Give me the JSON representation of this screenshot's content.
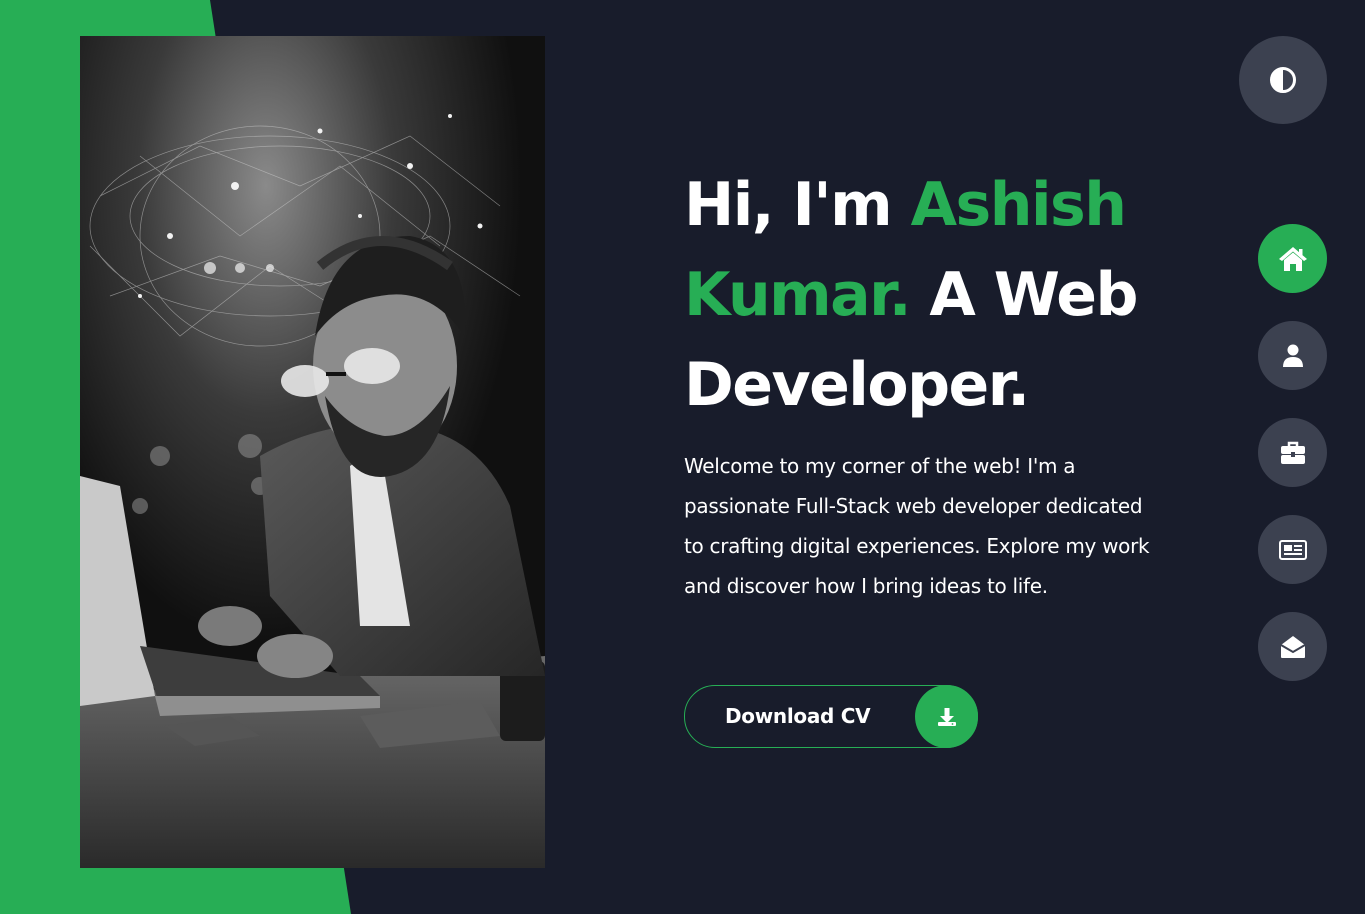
{
  "hero": {
    "greeting": "Hi, I'm ",
    "name": "Ashish Kumar.",
    "role": " A Web Developer.",
    "intro": "Welcome to my corner of the web! I'm a passionate Full-Stack web developer dedicated to crafting digital experiences. Explore my work and discover how I bring ideas to life."
  },
  "cv_button": {
    "label": "Download CV",
    "icon": "download-icon"
  },
  "theme_toggle": {
    "icon": "contrast-icon"
  },
  "nav": {
    "items": [
      {
        "icon": "home-icon",
        "active": true
      },
      {
        "icon": "user-icon",
        "active": false
      },
      {
        "icon": "briefcase-icon",
        "active": false
      },
      {
        "icon": "newspaper-icon",
        "active": false
      },
      {
        "icon": "envelope-open-icon",
        "active": false
      }
    ]
  },
  "colors": {
    "background": "#181c2b",
    "accent": "#27ae55",
    "button_gray": "#3c4150",
    "text": "#ffffff"
  }
}
